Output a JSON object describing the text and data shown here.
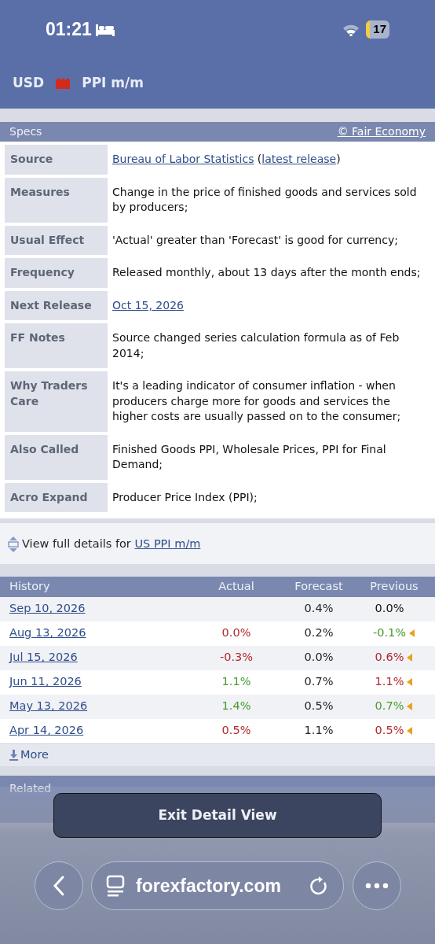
{
  "status_bar": {
    "time": "01:21",
    "battery": "17"
  },
  "header": {
    "currency": "USD",
    "impact_icon": {
      "color": "#d42a1c"
    },
    "title": "PPI m/m"
  },
  "specs": {
    "title": "Specs",
    "credit": "© Fair Economy",
    "rows": [
      {
        "label": "Source",
        "parts": [
          {
            "link": "Bureau of Labor Statistics"
          },
          {
            "text": " ("
          },
          {
            "link": "latest release"
          },
          {
            "text": ")"
          }
        ]
      },
      {
        "label": "Measures",
        "value": "Change in the price of finished goods and services sold by producers;"
      },
      {
        "label": "Usual Effect",
        "value": "'Actual' greater than 'Forecast' is good for currency;"
      },
      {
        "label": "Frequency",
        "value": "Released monthly, about 13 days after the month ends;"
      },
      {
        "label": "Next Release",
        "link": "Oct 15, 2026"
      },
      {
        "label": "FF Notes",
        "value": "Source changed series calculation formula as of Feb 2014;"
      },
      {
        "label": "Why Traders Care",
        "value": "It's a leading indicator of consumer inflation - when producers charge more for goods and services the higher costs are usually passed on to the consumer;"
      },
      {
        "label": "Also Called",
        "value": "Finished Goods PPI, Wholesale Prices, PPI for Final Demand;"
      },
      {
        "label": "Acro Expand",
        "value": "Producer Price Index (PPI);"
      }
    ]
  },
  "full_details": {
    "text": "View full details for",
    "link": "US PPI m/m"
  },
  "history": {
    "columns": [
      "History",
      "Actual",
      "Forecast",
      "Previous"
    ],
    "rows": [
      {
        "date": "Sep 10, 2026",
        "forecast": "0.4%",
        "previous": {
          "text": "0.0%"
        },
        "revised": false
      },
      {
        "date": "Aug 13, 2026",
        "actual": {
          "text": "0.0%",
          "color": "#b3282d"
        },
        "forecast": "0.2%",
        "previous": {
          "text": "-0.1%",
          "color": "#4a9a2f"
        },
        "revised": true
      },
      {
        "date": "Jul 15, 2026",
        "actual": {
          "text": "-0.3%",
          "color": "#b3282d"
        },
        "forecast": "0.0%",
        "previous": {
          "text": "0.6%",
          "color": "#b3282d"
        },
        "revised": true
      },
      {
        "date": "Jun 11, 2026",
        "actual": {
          "text": "1.1%",
          "color": "#4a9a2f"
        },
        "forecast": "0.7%",
        "previous": {
          "text": "1.1%",
          "color": "#b3282d"
        },
        "revised": true
      },
      {
        "date": "May 13, 2026",
        "actual": {
          "text": "1.4%",
          "color": "#4a9a2f"
        },
        "forecast": "0.5%",
        "previous": {
          "text": "0.7%",
          "color": "#4a9a2f"
        },
        "revised": true
      },
      {
        "date": "Apr 14, 2026",
        "actual": {
          "text": "0.5%",
          "color": "#b3282d"
        },
        "forecast": "1.1%",
        "previous": {
          "text": "0.5%",
          "color": "#b3282d"
        },
        "revised": true
      }
    ],
    "more": "More"
  },
  "related": {
    "title": "Related"
  },
  "exit_button": "Exit Detail View",
  "browser": {
    "url": "forexfactory.com"
  }
}
